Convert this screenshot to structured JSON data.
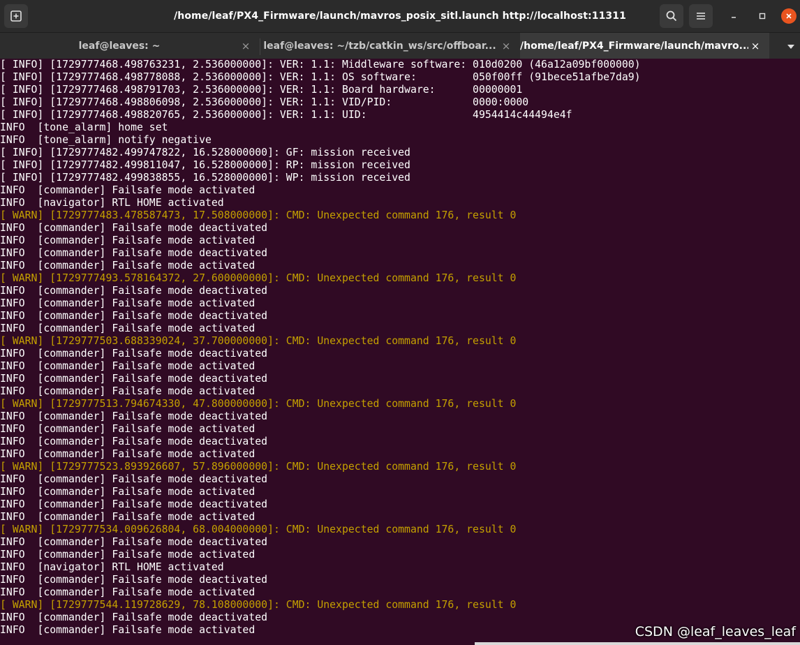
{
  "window": {
    "title": "/home/leaf/PX4_Firmware/launch/mavros_posix_sitl.launch http://localhost:11311"
  },
  "tabs": [
    {
      "label": "leaf@leaves: ~",
      "close": "×"
    },
    {
      "label": "leaf@leaves: ~/tzb/catkin_ws/src/offboar...",
      "close": "×"
    },
    {
      "label": "/home/leaf/PX4_Firmware/launch/mavro...",
      "close": "×"
    }
  ],
  "colors": {
    "warn": "#c4a000",
    "accent": "#e9541f",
    "background": "#300a24"
  },
  "lines": [
    {
      "text": "[ INFO] [1729777468.498763231, 2.536000000]: VER: 1.1: Middleware software: 010d0200 (46a12a09bf000000)",
      "level": "info"
    },
    {
      "text": "[ INFO] [1729777468.498778088, 2.536000000]: VER: 1.1: OS software:         050f00ff (91bece51afbe7da9)",
      "level": "info"
    },
    {
      "text": "[ INFO] [1729777468.498791703, 2.536000000]: VER: 1.1: Board hardware:      00000001",
      "level": "info"
    },
    {
      "text": "[ INFO] [1729777468.498806098, 2.536000000]: VER: 1.1: VID/PID:             0000:0000",
      "level": "info"
    },
    {
      "text": "[ INFO] [1729777468.498820765, 2.536000000]: VER: 1.1: UID:                 4954414c44494e4f",
      "level": "info"
    },
    {
      "text": "INFO  [tone_alarm] home set",
      "level": "info"
    },
    {
      "text": "INFO  [tone_alarm] notify negative",
      "level": "info"
    },
    {
      "text": "[ INFO] [1729777482.499747822, 16.528000000]: GF: mission received",
      "level": "info"
    },
    {
      "text": "[ INFO] [1729777482.499811047, 16.528000000]: RP: mission received",
      "level": "info"
    },
    {
      "text": "[ INFO] [1729777482.499838855, 16.528000000]: WP: mission received",
      "level": "info"
    },
    {
      "text": "INFO  [commander] Failsafe mode activated",
      "level": "info"
    },
    {
      "text": "INFO  [navigator] RTL HOME activated",
      "level": "info"
    },
    {
      "text": "[ WARN] [1729777483.478587473, 17.508000000]: CMD: Unexpected command 176, result 0",
      "level": "warn"
    },
    {
      "text": "INFO  [commander] Failsafe mode deactivated",
      "level": "info"
    },
    {
      "text": "INFO  [commander] Failsafe mode activated",
      "level": "info"
    },
    {
      "text": "INFO  [commander] Failsafe mode deactivated",
      "level": "info"
    },
    {
      "text": "INFO  [commander] Failsafe mode activated",
      "level": "info"
    },
    {
      "text": "[ WARN] [1729777493.578164372, 27.600000000]: CMD: Unexpected command 176, result 0",
      "level": "warn"
    },
    {
      "text": "INFO  [commander] Failsafe mode deactivated",
      "level": "info"
    },
    {
      "text": "INFO  [commander] Failsafe mode activated",
      "level": "info"
    },
    {
      "text": "INFO  [commander] Failsafe mode deactivated",
      "level": "info"
    },
    {
      "text": "INFO  [commander] Failsafe mode activated",
      "level": "info"
    },
    {
      "text": "[ WARN] [1729777503.688339024, 37.700000000]: CMD: Unexpected command 176, result 0",
      "level": "warn"
    },
    {
      "text": "INFO  [commander] Failsafe mode deactivated",
      "level": "info"
    },
    {
      "text": "INFO  [commander] Failsafe mode activated",
      "level": "info"
    },
    {
      "text": "INFO  [commander] Failsafe mode deactivated",
      "level": "info"
    },
    {
      "text": "INFO  [commander] Failsafe mode activated",
      "level": "info"
    },
    {
      "text": "[ WARN] [1729777513.794674330, 47.800000000]: CMD: Unexpected command 176, result 0",
      "level": "warn"
    },
    {
      "text": "INFO  [commander] Failsafe mode deactivated",
      "level": "info"
    },
    {
      "text": "INFO  [commander] Failsafe mode activated",
      "level": "info"
    },
    {
      "text": "INFO  [commander] Failsafe mode deactivated",
      "level": "info"
    },
    {
      "text": "INFO  [commander] Failsafe mode activated",
      "level": "info"
    },
    {
      "text": "[ WARN] [1729777523.893926607, 57.896000000]: CMD: Unexpected command 176, result 0",
      "level": "warn"
    },
    {
      "text": "INFO  [commander] Failsafe mode deactivated",
      "level": "info"
    },
    {
      "text": "INFO  [commander] Failsafe mode activated",
      "level": "info"
    },
    {
      "text": "INFO  [commander] Failsafe mode deactivated",
      "level": "info"
    },
    {
      "text": "INFO  [commander] Failsafe mode activated",
      "level": "info"
    },
    {
      "text": "[ WARN] [1729777534.009626804, 68.004000000]: CMD: Unexpected command 176, result 0",
      "level": "warn"
    },
    {
      "text": "INFO  [commander] Failsafe mode deactivated",
      "level": "info"
    },
    {
      "text": "INFO  [commander] Failsafe mode activated",
      "level": "info"
    },
    {
      "text": "INFO  [navigator] RTL HOME activated",
      "level": "info"
    },
    {
      "text": "INFO  [commander] Failsafe mode deactivated",
      "level": "info"
    },
    {
      "text": "INFO  [commander] Failsafe mode activated",
      "level": "info"
    },
    {
      "text": "[ WARN] [1729777544.119728629, 78.108000000]: CMD: Unexpected command 176, result 0",
      "level": "warn"
    },
    {
      "text": "INFO  [commander] Failsafe mode deactivated",
      "level": "info"
    },
    {
      "text": "INFO  [commander] Failsafe mode activated",
      "level": "info"
    }
  ],
  "watermark": "CSDN @leaf_leaves_leaf"
}
